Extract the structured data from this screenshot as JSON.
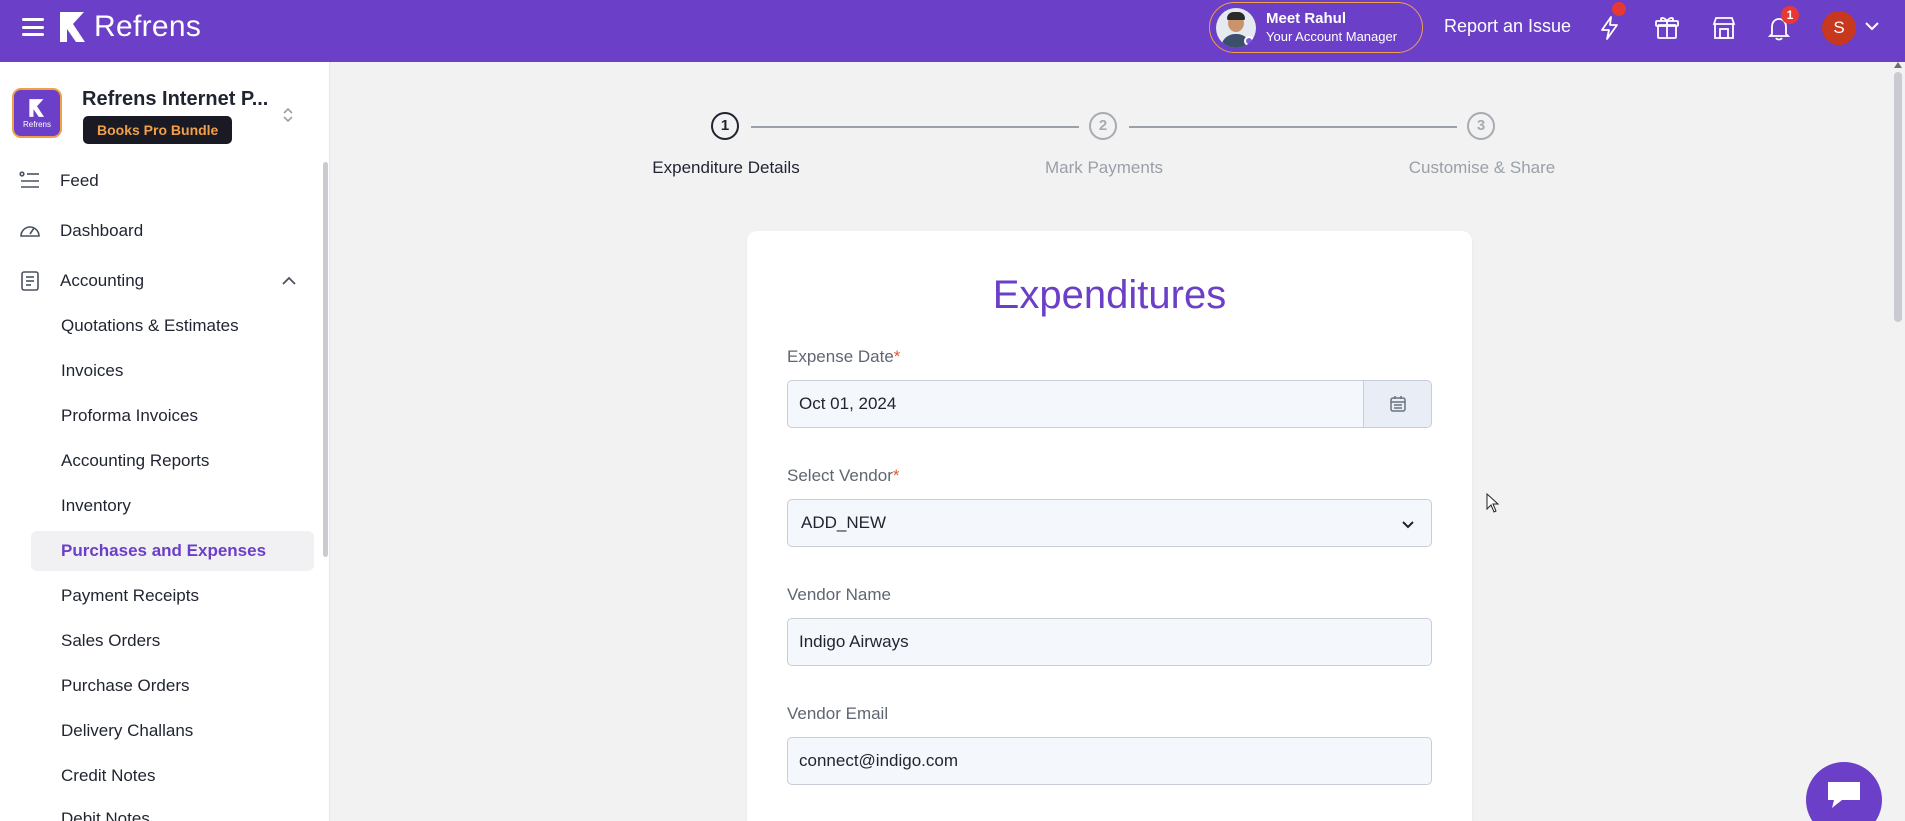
{
  "topbar": {
    "brand": "Refrens",
    "account_manager": {
      "name": "Meet Rahul",
      "role": "Your Account Manager"
    },
    "report_issue": "Report an Issue",
    "notification_count": "1",
    "user_initial": "S"
  },
  "sidebar": {
    "org_name": "Refrens Internet P...",
    "org_logo_text": "Refrens",
    "plan": "Books Pro Bundle",
    "nav": {
      "feed": "Feed",
      "dashboard": "Dashboard",
      "accounting": "Accounting"
    },
    "sub_items": [
      "Quotations & Estimates",
      "Invoices",
      "Proforma Invoices",
      "Accounting Reports",
      "Inventory",
      "Purchases and Expenses",
      "Payment Receipts",
      "Sales Orders",
      "Purchase Orders",
      "Delivery Challans",
      "Credit Notes",
      "Debit Notes"
    ],
    "active_item": "Purchases and Expenses"
  },
  "steps": [
    {
      "number": "1",
      "label": "Expenditure Details",
      "state": "active"
    },
    {
      "number": "2",
      "label": "Mark Payments",
      "state": "todo"
    },
    {
      "number": "3",
      "label": "Customise & Share",
      "state": "todo"
    }
  ],
  "form": {
    "title": "Expenditures",
    "expense_date": {
      "label": "Expense Date",
      "required_mark": "*",
      "value": "Oct 01, 2024"
    },
    "vendor": {
      "label": "Select Vendor",
      "required_mark": "*",
      "value": "ADD_NEW"
    },
    "vendor_name": {
      "label": "Vendor Name",
      "value": "Indigo Airways"
    },
    "vendor_email": {
      "label": "Vendor Email",
      "value": "connect@indigo.com"
    }
  },
  "colors": {
    "brand": "#6b3fc7",
    "accent_orange": "#f0a04b",
    "badge_red": "#e53935"
  }
}
